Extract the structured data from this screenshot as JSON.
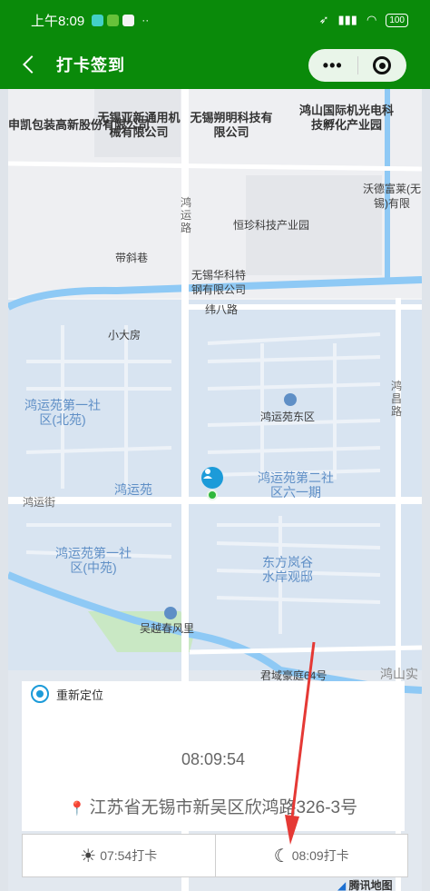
{
  "status_bar": {
    "time": "上午8:09",
    "battery": "100"
  },
  "nav": {
    "title": "打卡签到",
    "more": "•••"
  },
  "map": {
    "labels": [
      "申凯包装高新股份有限公司",
      "无锡亚新通用机械有限公司",
      "无锡朔明科技有限公司",
      "鸿山国际机光电科技孵化产业园",
      "沃德富莱(无锡)有限",
      "鸿运路",
      "恒珍科技产业园",
      "带斜巷",
      "无锡华科特钢有限公司",
      "纬八路",
      "小大房",
      "鸿运苑第一社区(北苑)",
      "鸿运苑东区",
      "鸿昌路",
      "鸿运苑第二社区六一期",
      "鸿运街",
      "鸿运苑",
      "鸿运苑第一社区(中苑)",
      "东方岚谷水岸观邸",
      "吴越春风里",
      "君域豪庭64号",
      "鸿山实"
    ],
    "attribution": "腾讯地图"
  },
  "card": {
    "relocate_label": "重新定位",
    "current_time": "08:09:54",
    "address": "江苏省无锡市新吴区欣鸿路326-3号"
  },
  "buttons": {
    "morning_label": "07:54打卡",
    "evening_label": "08:09打卡"
  },
  "colors": {
    "header": "#0a8a0a",
    "accent": "#1c9bd9",
    "arrow": "#e53935"
  }
}
